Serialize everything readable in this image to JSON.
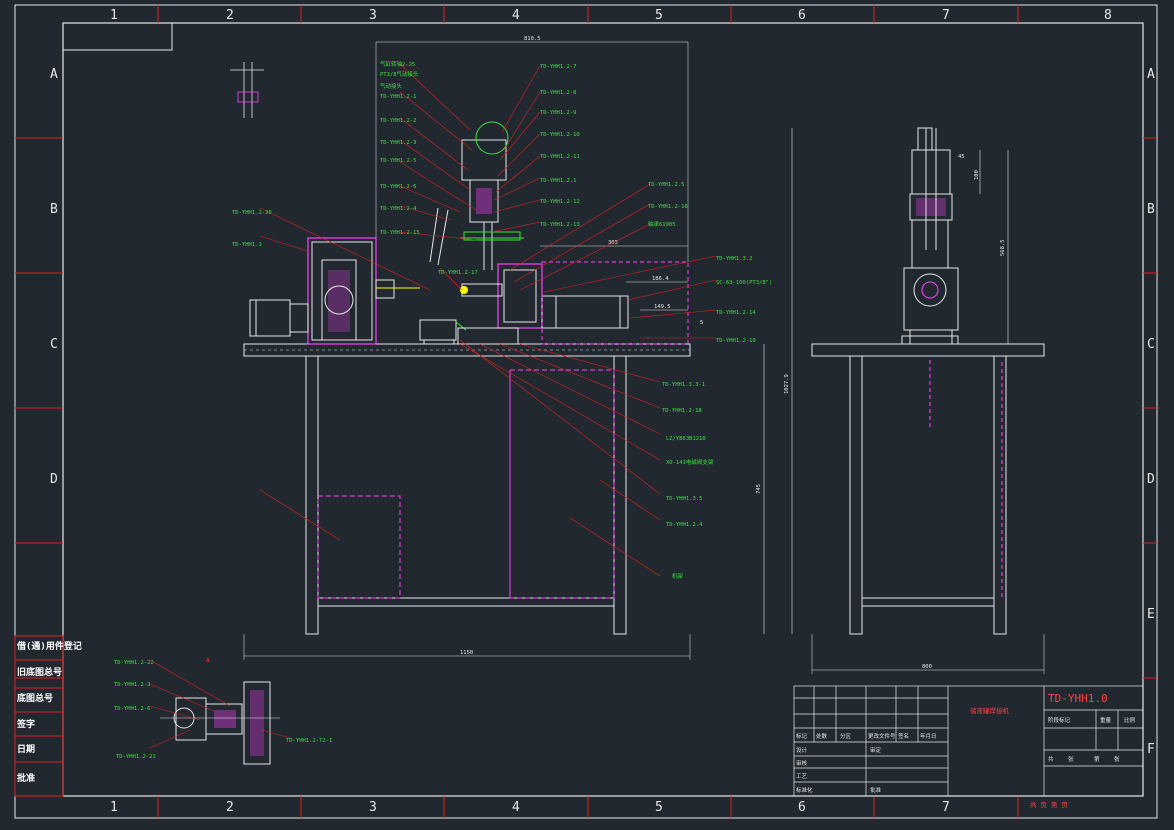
{
  "grid": {
    "columns": [
      "1",
      "2",
      "3",
      "4",
      "5",
      "6",
      "7",
      "8"
    ],
    "rows": [
      "A",
      "B",
      "C",
      "D",
      "E",
      "F"
    ]
  },
  "side_labels": [
    "旧底图总号",
    "底图总号",
    "签字",
    "日期",
    "批准"
  ],
  "side_label_top": "借(通)用件登记",
  "dimensions": {
    "top_width": "810.5",
    "right_height": "1027.9",
    "lower_height": "745",
    "bottom_width": "1150",
    "d_305": "305",
    "d_186": "186.4",
    "d_149": "149.5",
    "d_5": "5",
    "side_width": "800",
    "side_height": "568.5",
    "side_h1": "100",
    "side_h2": "45"
  },
  "labels": {
    "l1": "气缸转轴2-25",
    "l2": "PT1/8气动接头",
    "l3": "气动接头",
    "l4": "TD-YHH1.2-1",
    "l5": "TD-YHH1.2-2",
    "l6": "TD-YHH1.2-3",
    "l7": "TD-YHH1.2-5",
    "l8": "TD-YHH1.2-6",
    "l9": "TD-YHH1.2-4",
    "l10": "TD-YHH1.2-15",
    "l11": "TD-YHH1.2-7",
    "l12": "TD-YHH1.2-8",
    "l13": "TD-YHH1.2-9",
    "l14": "TD-YHH1.2-10",
    "l15": "TD-YHH1.2-11",
    "l16": "TD-YHH1.2.1",
    "l17": "TD-YHH1.2-12",
    "l18": "TD-YHH1.2-13",
    "l19": "TD-YHH1.2.5",
    "l20": "TD-YHH1.2-16",
    "l21": "轴承61905",
    "l22": "TD-YHH1.2-20",
    "l23": "TD-YHH1.1",
    "l24": "TD-YHH1.2-17",
    "l25": "TD-YHH1.3.2",
    "l26": "SC-63-100(PT3/8\")",
    "l27": "TD-YHH1.2-14",
    "l28": "TD-YHH1.2-19",
    "l29": "TD-YHH1.3.3-1",
    "l30": "TD-YHH1.2-18",
    "l31": "LZ/YB63B1210",
    "l32": "XO-141电磁阀支架",
    "l33": "TD-YHH1.3.5",
    "l34": "TD-YHH1.2.4",
    "l35": "机架",
    "l36": "TD-YHH1.2-22",
    "l37": "TD-YHH1.2-3",
    "l38": "TD-YHH1.2-6",
    "l39": "TD-YHH1.2-21",
    "l40": "TD-YHH1.2-T2-1"
  },
  "title_block": {
    "drawing_no": "TD-YHH1.0",
    "title": "储液罐焊接机",
    "cells": [
      "标记",
      "处数",
      "分区",
      "更改文件号",
      "签名",
      "年月日",
      "设计",
      "审定",
      "审核",
      "工艺",
      "标准化",
      "批准",
      "阶段标记",
      "重量",
      "比例",
      "共",
      "张",
      "第",
      "张"
    ],
    "footer": "共 页    第 页"
  }
}
